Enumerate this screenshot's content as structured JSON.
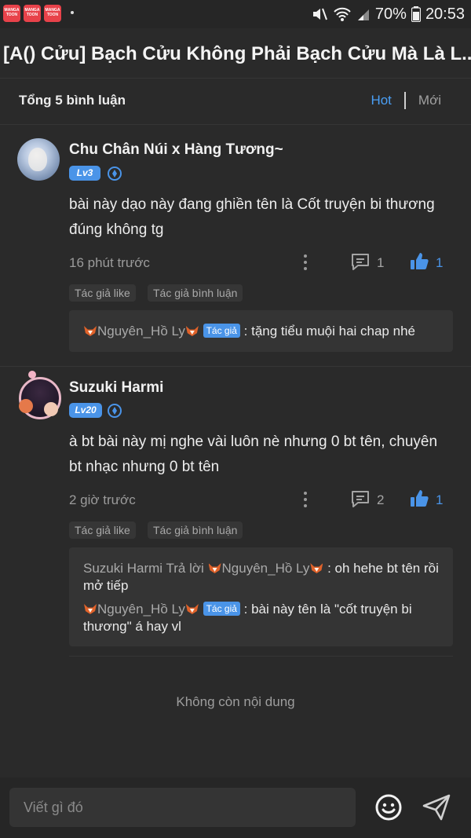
{
  "status_bar": {
    "apps": [
      {
        "line1": "MANGA",
        "line2": "TOON"
      },
      {
        "line1": "MANGA",
        "line2": "TOON"
      },
      {
        "line1": "MANGA",
        "line2": "TOON"
      }
    ],
    "battery": "70%",
    "time": "20:53",
    "icons": [
      "mute-icon",
      "wifi-icon",
      "signal-icon",
      "battery-icon"
    ]
  },
  "page": {
    "title": "[A() Cửu] Bạch Cửu Không Phải Bạch Cửu Mà Là L...",
    "total_comments": "Tổng 5 bình luận",
    "sort": {
      "hot": "Hot",
      "new": "Mới"
    }
  },
  "comments": [
    {
      "username": "Chu Chân Núi x Hàng Tương~",
      "level": "Lv3",
      "text": "bài này dạo này đang ghiền tên là Cốt truyện bi thương đúng không tg",
      "time": "16 phút trước",
      "reply_count": "1",
      "like_count": "1",
      "tags": [
        "Tác giả like",
        "Tác giả bình luận"
      ],
      "replies": [
        {
          "from": "Nguyên_Hồ Ly",
          "author_tag": "Tác giả",
          "text": ": tặng tiểu muội hai chap nhé"
        }
      ]
    },
    {
      "username": "Suzuki Harmi",
      "level": "Lv20",
      "text": "à bt bài này mị nghe vài luôn nè nhưng 0 bt tên, chuyên bt nhạc nhưng 0 bt tên",
      "time": "2 giờ trước",
      "reply_count": "2",
      "like_count": "1",
      "tags": [
        "Tác giả like",
        "Tác giả bình luận"
      ],
      "replies": [
        {
          "from": "Suzuki Harmi Trả lời",
          "to": "Nguyên_Hồ Ly",
          "text": ": oh hehe bt tên rồi mở tiếp"
        },
        {
          "from": "Nguyên_Hồ Ly",
          "author_tag": "Tác giả",
          "text": ": bài này tên là \"cốt truyện bi thương\" á hay vl"
        }
      ]
    }
  ],
  "end_text": "Không còn nội dung",
  "composer": {
    "placeholder": "Viết gì đó"
  },
  "colors": {
    "accent": "#4a94e8",
    "background": "#2a2a2a",
    "panel": "#343434"
  }
}
